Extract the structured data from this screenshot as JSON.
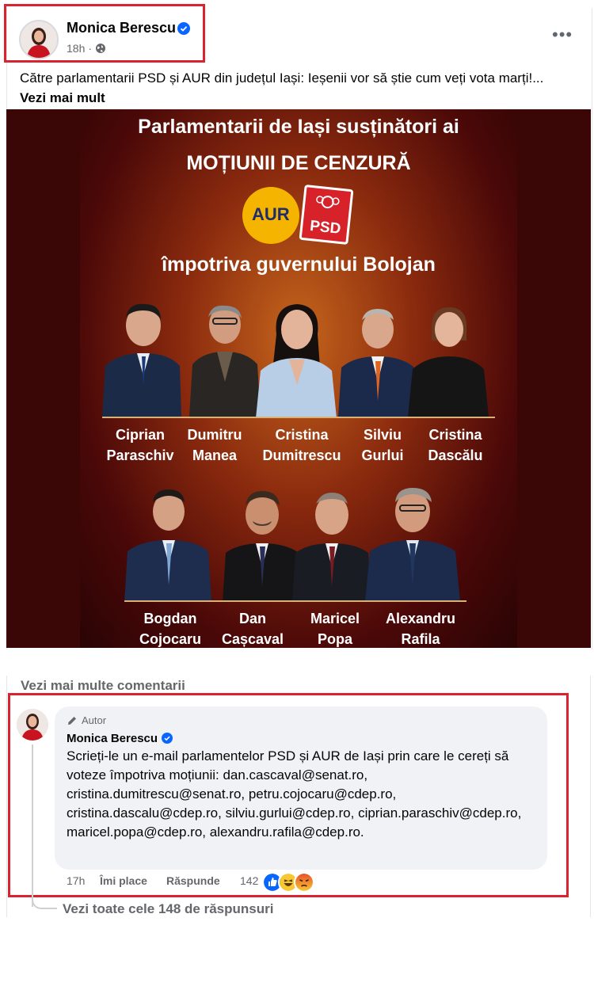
{
  "post": {
    "author": "Monica Berescu",
    "time": "18h",
    "text": "Către parlamentarii PSD și AUR din județul Iași: Ieșenii vor să știe cum veți vota marți!...",
    "see_more": "Vezi mai mult",
    "more_icon": "more-dots-icon",
    "privacy_icon": "globe-icon"
  },
  "poster": {
    "title_line1": "Parlamentarii de Iași susținători ai",
    "title_line2": "MOȚIUNII DE CENZURĂ",
    "logo_aur": "AUR",
    "logo_psd": "PSD",
    "subtitle": "împotriva guvernului Bolojan",
    "row1": [
      {
        "first": "Ciprian",
        "last": "Paraschiv"
      },
      {
        "first": "Dumitru",
        "last": "Manea"
      },
      {
        "first": "Cristina",
        "last": "Dumitrescu"
      },
      {
        "first": "Silviu",
        "last": "Gurlui"
      },
      {
        "first": "Cristina",
        "last": "Dascălu"
      }
    ],
    "row2": [
      {
        "first": "Bogdan",
        "last": "Cojocaru"
      },
      {
        "first": "Dan",
        "last": "Cașcaval"
      },
      {
        "first": "Maricel",
        "last": "Popa"
      },
      {
        "first": "Alexandru",
        "last": "Rafila"
      }
    ]
  },
  "comments": {
    "more_label": "Vezi mai multe comentarii",
    "comment": {
      "badge": "Autor",
      "author": "Monica Berescu",
      "text": "Scrieți-le un e-mail parlamentelor PSD și AUR de Iași prin care le cereți să voteze împotriva moțiunii: dan.cascaval@senat.ro, cristina.dumitrescu@senat.ro, petru.cojocaru@cdep.ro, cristina.dascalu@cdep.ro, silviu.gurlui@cdep.ro, ciprian.paraschiv@cdep.ro, maricel.popa@cdep.ro, alexandru.rafila@cdep.ro.",
      "time": "17h",
      "like_label": "Îmi place",
      "reply_label": "Răspunde",
      "reaction_count": "142",
      "reactions": [
        "like-icon",
        "haha-icon",
        "angry-icon"
      ]
    },
    "replies_label": "Vezi toate cele 148 de răspunsuri"
  },
  "colors": {
    "highlight": "#d9232e",
    "verified": "#0866ff",
    "secondary_text": "#65676b"
  }
}
